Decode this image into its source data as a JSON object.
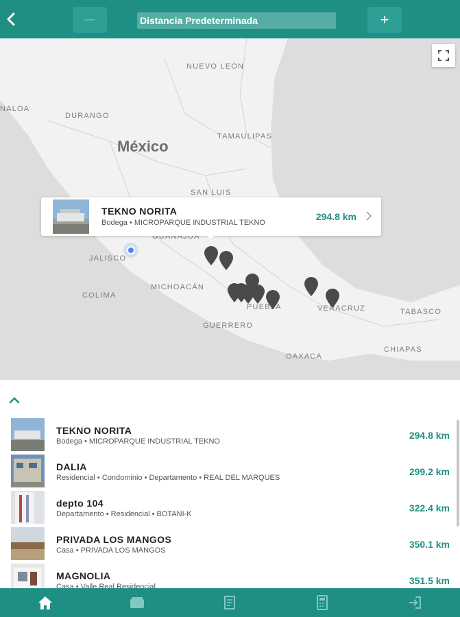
{
  "header": {
    "back_icon": "chevron-left-icon",
    "minus_label": "—",
    "plus_label": "+",
    "distance_label": "Distancia Predeterminada",
    "colors": {
      "bar": "#1f8f84",
      "button": "#2e9f94"
    }
  },
  "map": {
    "labels": {
      "country": "México",
      "nuevo_leon": "NUEVO LEÓN",
      "sinaloa": "NALOA",
      "durango": "DURANGO",
      "tamaulipas": "TAMAULIPAS",
      "san_luis": "SAN LUIS",
      "guanajuato": "GUANAJUA",
      "jalisco": "JALISCO",
      "michoacan": "MICHOACÁN",
      "colima": "COLIMA",
      "puebla": "PUEBLA",
      "veracruz": "VERACRUZ",
      "tabasco": "TABASCO",
      "guerrero": "GUERRERO",
      "oaxaca": "OAXACA",
      "chiapas": "CHIAPAS"
    },
    "popup": {
      "name": "TEKNO NORITA",
      "subtitle": "Bodega • MICROPARQUE INDUSTRIAL TEKNO",
      "distance": "294.8 km"
    }
  },
  "list": [
    {
      "name": "TEKNO NORITA",
      "subtitle": "Bodega • MICROPARQUE INDUSTRIAL TEKNO",
      "distance": "294.8 km"
    },
    {
      "name": "DALIA",
      "subtitle": "Residencial • Condominio • Departamento • REAL DEL MARQUES",
      "distance": "299.2 km"
    },
    {
      "name": "depto 104",
      "subtitle": "Departamento • Residencial • BOTANI-K",
      "distance": "322.4 km"
    },
    {
      "name": "PRIVADA LOS MANGOS",
      "subtitle": "Casa • PRIVADA LOS MANGOS",
      "distance": "350.1 km"
    },
    {
      "name": "MAGNOLIA",
      "subtitle": "Casa • Valle Real Residencial",
      "distance": "351.5 km"
    }
  ],
  "bottom_nav": {
    "items": [
      "home-icon",
      "inbox-icon",
      "document-icon",
      "calculator-icon",
      "logout-icon"
    ]
  }
}
